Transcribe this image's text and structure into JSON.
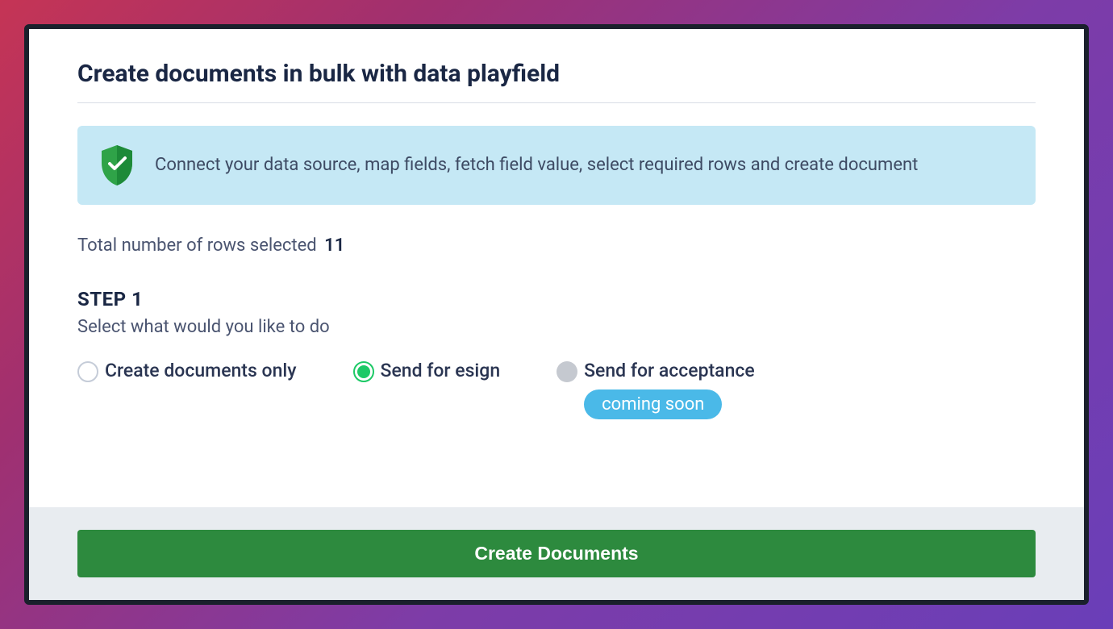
{
  "modal": {
    "title": "Create documents in bulk with data playfield",
    "info_banner": {
      "text": "Connect your data source, map fields, fetch field value, select required rows and create document",
      "icon": "shield-check-icon"
    },
    "rows_selected": {
      "label": "Total number of rows selected",
      "count": "11"
    },
    "step": {
      "heading": "STEP 1",
      "subtitle": "Select what would you like to do"
    },
    "options": [
      {
        "label": "Create documents only",
        "selected": false,
        "disabled": false
      },
      {
        "label": "Send for esign",
        "selected": true,
        "disabled": false
      },
      {
        "label": "Send for acceptance",
        "selected": false,
        "disabled": true,
        "badge": "coming soon"
      }
    ],
    "footer": {
      "button_label": "Create Documents"
    }
  },
  "colors": {
    "accent_green": "#1dc966",
    "button_green": "#2d8a3e",
    "badge_blue": "#4ab9e8",
    "banner_bg": "#c5e8f5",
    "text_dark": "#1a2744",
    "text_muted": "#4a5470"
  }
}
